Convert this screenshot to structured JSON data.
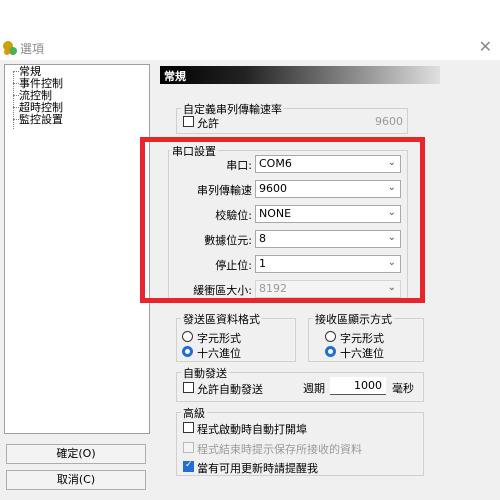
{
  "window": {
    "title": "選項",
    "close_glyph": "✕"
  },
  "tree": {
    "items": [
      "常規",
      "事件控制",
      "流控制",
      "超時控制",
      "監控設置"
    ]
  },
  "buttons": {
    "ok": "確定(O)",
    "cancel": "取消(C)"
  },
  "header": {
    "title": "常規"
  },
  "custom_baud": {
    "group_label": "自定義串列傳輸速率",
    "allow_label": "允許",
    "value": "9600",
    "allow_checked": false
  },
  "serial": {
    "group_label": "串口設置",
    "port": {
      "label": "串口:",
      "value": "COM6"
    },
    "baud": {
      "label": "串列傳輸速",
      "value": "9600"
    },
    "parity": {
      "label": "校驗位:",
      "value": "NONE"
    },
    "databits": {
      "label": "數據位元:",
      "value": "8"
    },
    "stopbits": {
      "label": "停止位:",
      "value": "1"
    },
    "buffer": {
      "label": "緩衝區大小:",
      "value": "8192"
    }
  },
  "send_format": {
    "group_label": "發送區資料格式",
    "opt_char": "字元形式",
    "opt_hex": "十六進位",
    "selected": "hex"
  },
  "recv_format": {
    "group_label": "接收區顯示方式",
    "opt_char": "字元形式",
    "opt_hex": "十六進位",
    "selected": "hex"
  },
  "auto_send": {
    "group_label": "自動發送",
    "allow_label": "允許自動發送",
    "period_label": "週期",
    "period_value": "1000",
    "unit": "毫秒",
    "checked": false
  },
  "advanced": {
    "group_label": "高級",
    "open_on_start": "程式啟動時自動打開埠",
    "prompt_save": "程式結束時提示保存所接收的資料",
    "update_prompt": "當有可用更新時請提醒我",
    "open_on_start_checked": false,
    "prompt_save_checked": false,
    "update_prompt_checked": true
  },
  "colors": {
    "highlight_red": "#e8262a",
    "accent_blue": "#1f6fd6"
  },
  "icons": {
    "app_icon": "app-options-icon",
    "dropdown": "chevron-down-icon"
  }
}
